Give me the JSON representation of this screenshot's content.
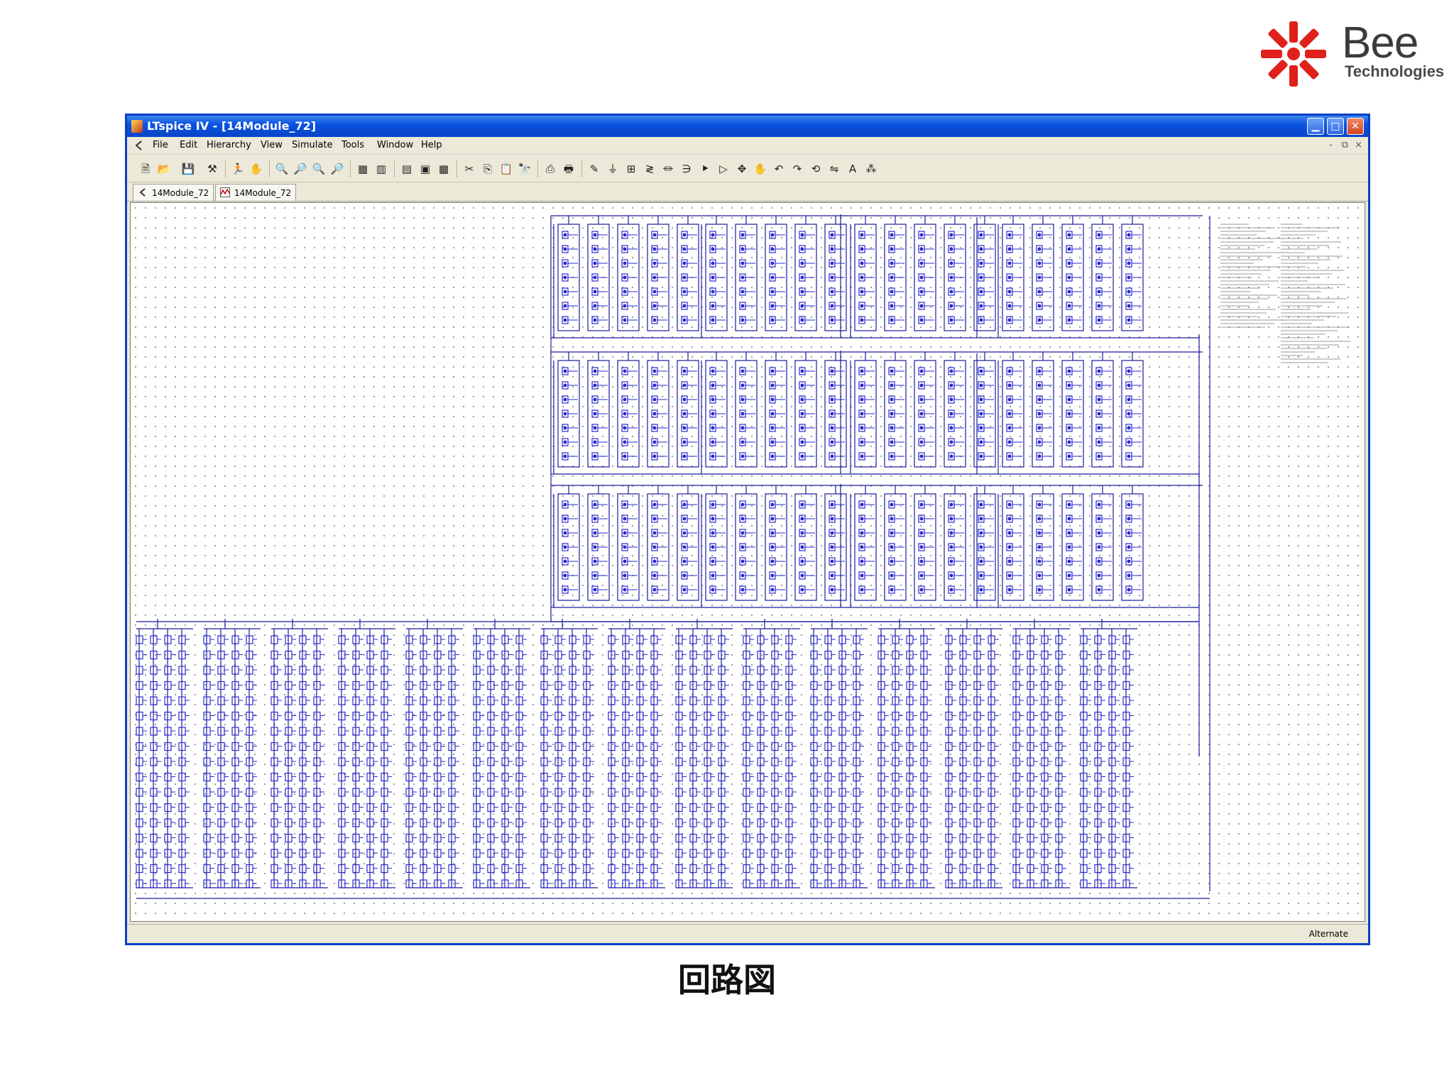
{
  "logo": {
    "name": "Bee",
    "subtitle": "Technologies"
  },
  "window": {
    "title": "LTspice IV - [14Module_72]",
    "min_glyph": "▁",
    "max_glyph": "□",
    "close_glyph": "✕"
  },
  "menu": {
    "items": [
      "File",
      "Edit",
      "Hierarchy",
      "View",
      "Simulate",
      "Tools",
      "Window",
      "Help"
    ],
    "mdi_min": "-",
    "mdi_restore": "⧉",
    "mdi_close": "×"
  },
  "tabs": [
    {
      "label": "14Module_72",
      "icon": "schematic-icon"
    },
    {
      "label": "14Module_72",
      "icon": "waveform-icon"
    }
  ],
  "status": {
    "text": "Alternate"
  },
  "caption": "回路図",
  "colors": {
    "accent": "#0a3fc4",
    "wire": "#1a1a9e",
    "component": "#2a2ad0"
  }
}
